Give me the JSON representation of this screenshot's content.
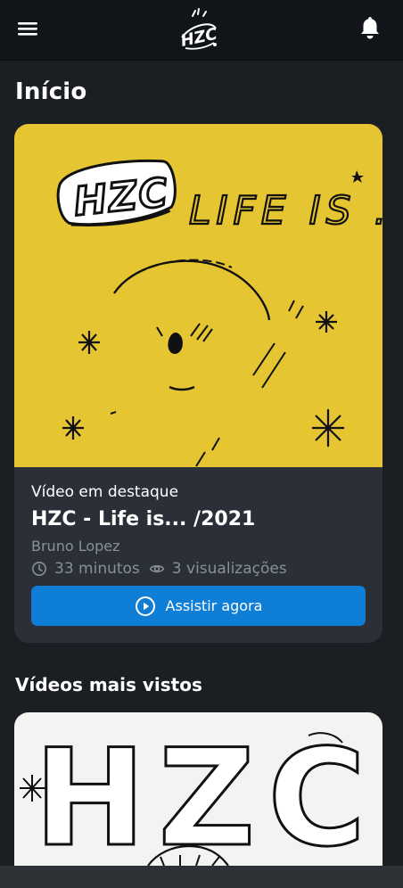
{
  "header": {
    "logo_text": "HZC",
    "menu_icon": "hamburger-menu-icon",
    "bell_icon": "bell-icon"
  },
  "page": {
    "title": "Início"
  },
  "featured": {
    "art_text": "HZC",
    "art_caption": "LIFE IS ...",
    "label": "Vídeo em destaque",
    "title": "HZC - Life is... /2021",
    "author": "Bruno Lopez",
    "duration": "33 minutos",
    "views": "3 visualizações",
    "cta": "Assistir agora"
  },
  "most_viewed": {
    "title": "Vídeos mais vistos",
    "items": [
      {
        "art_text": "HZC"
      }
    ]
  },
  "colors": {
    "background": "#1b1f24",
    "topbar": "#111418",
    "card": "#2b3038",
    "accent": "#0f7ed6",
    "featured_art": "#e6c532"
  }
}
